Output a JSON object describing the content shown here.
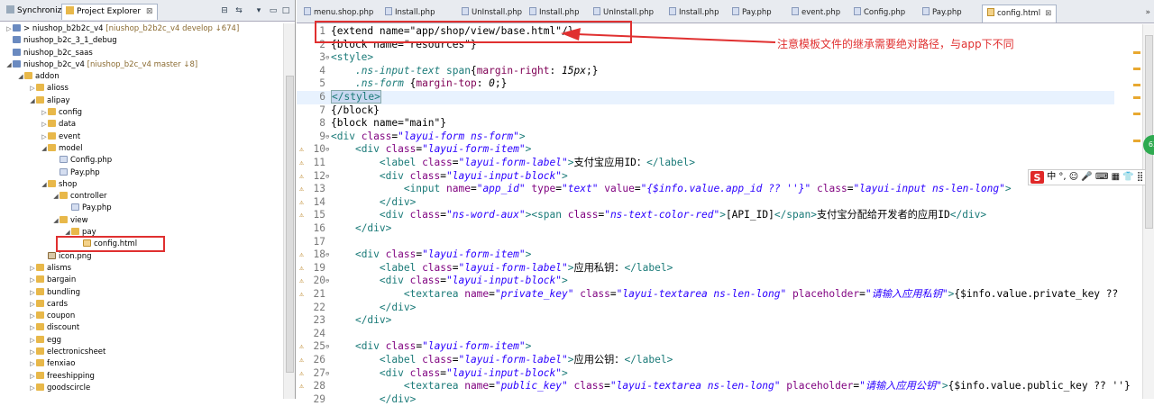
{
  "left_panel": {
    "tabs": [
      {
        "label": "Synchronize"
      },
      {
        "label": "Project Explorer"
      }
    ],
    "close_glyph": "⊠",
    "tree": [
      {
        "indent": 0,
        "tw": "▷",
        "icon": "proj",
        "label": "niushop_b2b2c_v4",
        "prefix": "> ",
        "meta": "[niushop_b2b2c_v4 develop ↓674]"
      },
      {
        "indent": 0,
        "tw": "",
        "icon": "proj",
        "label": "niushop_b2c_3_1_debug",
        "meta": ""
      },
      {
        "indent": 0,
        "tw": "",
        "icon": "proj",
        "label": "niushop_b2c_saas",
        "meta": ""
      },
      {
        "indent": 0,
        "tw": "◢",
        "icon": "proj",
        "label": "niushop_b2c_v4",
        "meta": "[niushop_b2c_v4 master ↓8]"
      },
      {
        "indent": 1,
        "tw": "◢",
        "icon": "folder",
        "label": "addon",
        "meta": ""
      },
      {
        "indent": 2,
        "tw": "▷",
        "icon": "folder",
        "label": "alioss",
        "meta": ""
      },
      {
        "indent": 2,
        "tw": "◢",
        "icon": "folder",
        "label": "alipay",
        "meta": ""
      },
      {
        "indent": 3,
        "tw": "▷",
        "icon": "folder",
        "label": "config",
        "meta": ""
      },
      {
        "indent": 3,
        "tw": "▷",
        "icon": "folder",
        "label": "data",
        "meta": ""
      },
      {
        "indent": 3,
        "tw": "▷",
        "icon": "folder",
        "label": "event",
        "meta": ""
      },
      {
        "indent": 3,
        "tw": "◢",
        "icon": "folder",
        "label": "model",
        "meta": ""
      },
      {
        "indent": 4,
        "tw": "",
        "icon": "file-php",
        "label": "Config.php",
        "meta": ""
      },
      {
        "indent": 4,
        "tw": "",
        "icon": "file-php",
        "label": "Pay.php",
        "meta": ""
      },
      {
        "indent": 3,
        "tw": "◢",
        "icon": "folder",
        "label": "shop",
        "meta": ""
      },
      {
        "indent": 4,
        "tw": "◢",
        "icon": "folder",
        "label": "controller",
        "meta": ""
      },
      {
        "indent": 5,
        "tw": "",
        "icon": "file-php",
        "label": "Pay.php",
        "meta": ""
      },
      {
        "indent": 4,
        "tw": "◢",
        "icon": "folder",
        "label": "view",
        "meta": ""
      },
      {
        "indent": 5,
        "tw": "◢",
        "icon": "folder",
        "label": "pay",
        "meta": ""
      },
      {
        "indent": 6,
        "tw": "",
        "icon": "file-html",
        "label": "config.html",
        "meta": ""
      },
      {
        "indent": 3,
        "tw": "",
        "icon": "file-png",
        "label": "icon.png",
        "meta": ""
      },
      {
        "indent": 2,
        "tw": "▷",
        "icon": "folder",
        "label": "alisms",
        "meta": ""
      },
      {
        "indent": 2,
        "tw": "▷",
        "icon": "folder",
        "label": "bargain",
        "meta": ""
      },
      {
        "indent": 2,
        "tw": "▷",
        "icon": "folder",
        "label": "bundling",
        "meta": ""
      },
      {
        "indent": 2,
        "tw": "▷",
        "icon": "folder",
        "label": "cards",
        "meta": ""
      },
      {
        "indent": 2,
        "tw": "▷",
        "icon": "folder",
        "label": "coupon",
        "meta": ""
      },
      {
        "indent": 2,
        "tw": "▷",
        "icon": "folder",
        "label": "discount",
        "meta": ""
      },
      {
        "indent": 2,
        "tw": "▷",
        "icon": "folder",
        "label": "egg",
        "meta": ""
      },
      {
        "indent": 2,
        "tw": "▷",
        "icon": "folder",
        "label": "electronicsheet",
        "meta": ""
      },
      {
        "indent": 2,
        "tw": "▷",
        "icon": "folder",
        "label": "fenxiao",
        "meta": ""
      },
      {
        "indent": 2,
        "tw": "▷",
        "icon": "folder",
        "label": "freeshipping",
        "meta": ""
      },
      {
        "indent": 2,
        "tw": "▷",
        "icon": "folder",
        "label": "goodscircle",
        "meta": ""
      }
    ]
  },
  "editor": {
    "tabs": [
      "menu.shop.php",
      "Install.php",
      "UnInstall.php",
      "Install.php",
      "UnInstall.php",
      "Install.php",
      "Pay.php",
      "event.php",
      "Config.php",
      "Pay.php",
      "config.html"
    ],
    "active_tab": "config.html",
    "active_close": "⊠",
    "lines": [
      {
        "n": "1",
        "marker": "",
        "fold": "",
        "html": "{extend name=\"app/shop/view/base.html\"/}"
      },
      {
        "n": "2",
        "marker": "",
        "fold": "",
        "html": "{block name=\"resources\"}"
      },
      {
        "n": "3",
        "marker": "",
        "fold": "⊖",
        "html": "<span class=\"tag\">&lt;style&gt;</span>"
      },
      {
        "n": "4",
        "marker": "",
        "fold": "",
        "html": "    <span class=\"sel\"><i>.ns-input-text</i> span</span>{<span class=\"prop\">margin-right</span>: <span class=\"pv\">15px</span>;}"
      },
      {
        "n": "5",
        "marker": "",
        "fold": "",
        "html": "    <span class=\"sel\"><i>.ns-form</i></span> {<span class=\"prop\">margin-top</span>: <span class=\"pv\">0</span>;}"
      },
      {
        "n": "6",
        "marker": "",
        "fold": "",
        "html": "<span class=\"tag match\">&lt;/style&gt;</span>",
        "current": true
      },
      {
        "n": "7",
        "marker": "",
        "fold": "",
        "html": "{/block}"
      },
      {
        "n": "8",
        "marker": "",
        "fold": "",
        "html": "{block name=\"main\"}"
      },
      {
        "n": "9",
        "marker": "",
        "fold": "⊖",
        "html": "<span class=\"tag\">&lt;div</span> <span class=\"attr\">class</span>=<span class=\"it\">\"layui-form ns-form\"</span><span class=\"tag\">&gt;</span>"
      },
      {
        "n": "10",
        "marker": "⚠",
        "fold": "⊖",
        "html": "    <span class=\"tag\">&lt;div</span> <span class=\"attr\">class</span>=<span class=\"it\">\"layui-form-item\"</span><span class=\"tag\">&gt;</span>"
      },
      {
        "n": "11",
        "marker": "⚠",
        "fold": "",
        "html": "        <span class=\"tag\">&lt;label</span> <span class=\"attr\">class</span>=<span class=\"it\">\"layui-form-label\"</span><span class=\"tag\">&gt;</span>支付宝应用ID：<span class=\"tag\">&lt;/label&gt;</span>"
      },
      {
        "n": "12",
        "marker": "⚠",
        "fold": "⊖",
        "html": "        <span class=\"tag\">&lt;div</span> <span class=\"attr\">class</span>=<span class=\"it\">\"layui-input-block\"</span><span class=\"tag\">&gt;</span>"
      },
      {
        "n": "13",
        "marker": "⚠",
        "fold": "",
        "html": "            <span class=\"tag\">&lt;input</span> <span class=\"attr\">name</span>=<span class=\"it\">\"app_id\"</span> <span class=\"attr\">type</span>=<span class=\"it\">\"text\"</span> <span class=\"attr\">value</span>=<span class=\"it\">\"{$info.value.app_id ?? ''}\"</span> <span class=\"attr\">class</span>=<span class=\"it\">\"layui-input ns-len-long\"</span><span class=\"tag\">&gt;</span>"
      },
      {
        "n": "14",
        "marker": "⚠",
        "fold": "",
        "html": "        <span class=\"tag\">&lt;/div&gt;</span>"
      },
      {
        "n": "15",
        "marker": "⚠",
        "fold": "",
        "html": "        <span class=\"tag\">&lt;div</span> <span class=\"attr\">class</span>=<span class=\"it\">\"ns-word-aux\"</span><span class=\"tag\">&gt;&lt;span</span> <span class=\"attr\">class</span>=<span class=\"it\">\"ns-text-color-red\"</span><span class=\"tag\">&gt;</span>[API_ID]<span class=\"tag\">&lt;/span&gt;</span>支付宝分配给开发者的应用ID<span class=\"tag\">&lt;/div&gt;</span>"
      },
      {
        "n": "16",
        "marker": "",
        "fold": "",
        "html": "    <span class=\"tag\">&lt;/div&gt;</span>"
      },
      {
        "n": "17",
        "marker": "",
        "fold": "",
        "html": ""
      },
      {
        "n": "18",
        "marker": "⚠",
        "fold": "⊖",
        "html": "    <span class=\"tag\">&lt;div</span> <span class=\"attr\">class</span>=<span class=\"it\">\"layui-form-item\"</span><span class=\"tag\">&gt;</span>"
      },
      {
        "n": "19",
        "marker": "⚠",
        "fold": "",
        "html": "        <span class=\"tag\">&lt;label</span> <span class=\"attr\">class</span>=<span class=\"it\">\"layui-form-label\"</span><span class=\"tag\">&gt;</span>应用私钥：<span class=\"tag\">&lt;/label&gt;</span>"
      },
      {
        "n": "20",
        "marker": "⚠",
        "fold": "⊖",
        "html": "        <span class=\"tag\">&lt;div</span> <span class=\"attr\">class</span>=<span class=\"it\">\"layui-input-block\"</span><span class=\"tag\">&gt;</span>"
      },
      {
        "n": "21",
        "marker": "⚠",
        "fold": "",
        "html": "            <span class=\"tag\">&lt;textarea</span> <span class=\"attr\">name</span>=<span class=\"it\">\"private_key\"</span> <span class=\"attr\">class</span>=<span class=\"it\">\"layui-textarea ns-len-long\"</span> <span class=\"attr\">placeholder</span>=<span class=\"it\">\"请输入应用私钥\"</span><span class=\"tag\">&gt;</span>{$info.value.private_key ??"
      },
      {
        "n": "22",
        "marker": "",
        "fold": "",
        "html": "        <span class=\"tag\">&lt;/div&gt;</span>"
      },
      {
        "n": "23",
        "marker": "",
        "fold": "",
        "html": "    <span class=\"tag\">&lt;/div&gt;</span>"
      },
      {
        "n": "24",
        "marker": "",
        "fold": "",
        "html": ""
      },
      {
        "n": "25",
        "marker": "⚠",
        "fold": "⊖",
        "html": "    <span class=\"tag\">&lt;div</span> <span class=\"attr\">class</span>=<span class=\"it\">\"layui-form-item\"</span><span class=\"tag\">&gt;</span>"
      },
      {
        "n": "26",
        "marker": "⚠",
        "fold": "",
        "html": "        <span class=\"tag\">&lt;label</span> <span class=\"attr\">class</span>=<span class=\"it\">\"layui-form-label\"</span><span class=\"tag\">&gt;</span>应用公钥：<span class=\"tag\">&lt;/label&gt;</span>"
      },
      {
        "n": "27",
        "marker": "⚠",
        "fold": "⊖",
        "html": "        <span class=\"tag\">&lt;div</span> <span class=\"attr\">class</span>=<span class=\"it\">\"layui-input-block\"</span><span class=\"tag\">&gt;</span>"
      },
      {
        "n": "28",
        "marker": "⚠",
        "fold": "",
        "html": "            <span class=\"tag\">&lt;textarea</span> <span class=\"attr\">name</span>=<span class=\"it\">\"public_key\"</span> <span class=\"attr\">class</span>=<span class=\"it\">\"layui-textarea ns-len-long\"</span> <span class=\"attr\">placeholder</span>=<span class=\"it\">\"请输入应用公钥\"</span><span class=\"tag\">&gt;</span>{$info.value.public_key ?? ''}"
      },
      {
        "n": "29",
        "marker": "",
        "fold": "",
        "html": "        <span class=\"tag\">&lt;/div&gt;</span>"
      }
    ]
  },
  "annotation": {
    "text": "注意模板文件的继承需要绝对路径，与app下不同",
    "color": "#e03030"
  },
  "ime_bar": {
    "logo": "S",
    "text": "中 °,  ☺ 🎤 ⌨ ▦ 👕 ⣿"
  },
  "badge": {
    "text": "63"
  }
}
